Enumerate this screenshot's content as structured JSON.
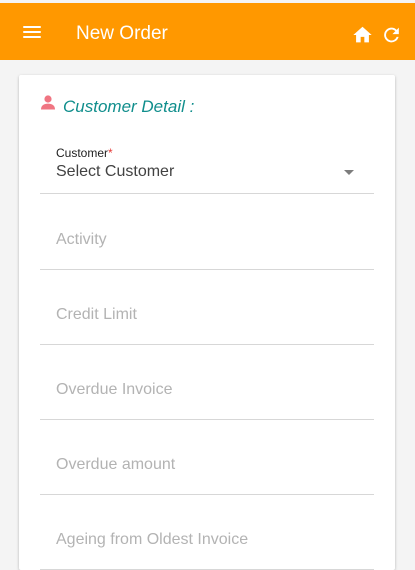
{
  "app_bar": {
    "title": "New Order",
    "menu_icon": "menu-icon",
    "actions": [
      "home-icon",
      "refresh-icon"
    ],
    "color": "#ff9800"
  },
  "section": {
    "icon": "person-icon",
    "title": "Customer Detail :",
    "title_color": "#108e8c",
    "icon_color": "#f07582"
  },
  "customer_select": {
    "label": "Customer",
    "required_mark": "*",
    "value": "Select Customer"
  },
  "fields": [
    {
      "placeholder": "Activity"
    },
    {
      "placeholder": "Credit Limit"
    },
    {
      "placeholder": "Overdue Invoice"
    },
    {
      "placeholder": "Overdue amount"
    },
    {
      "placeholder": "Ageing from Oldest Invoice"
    }
  ]
}
